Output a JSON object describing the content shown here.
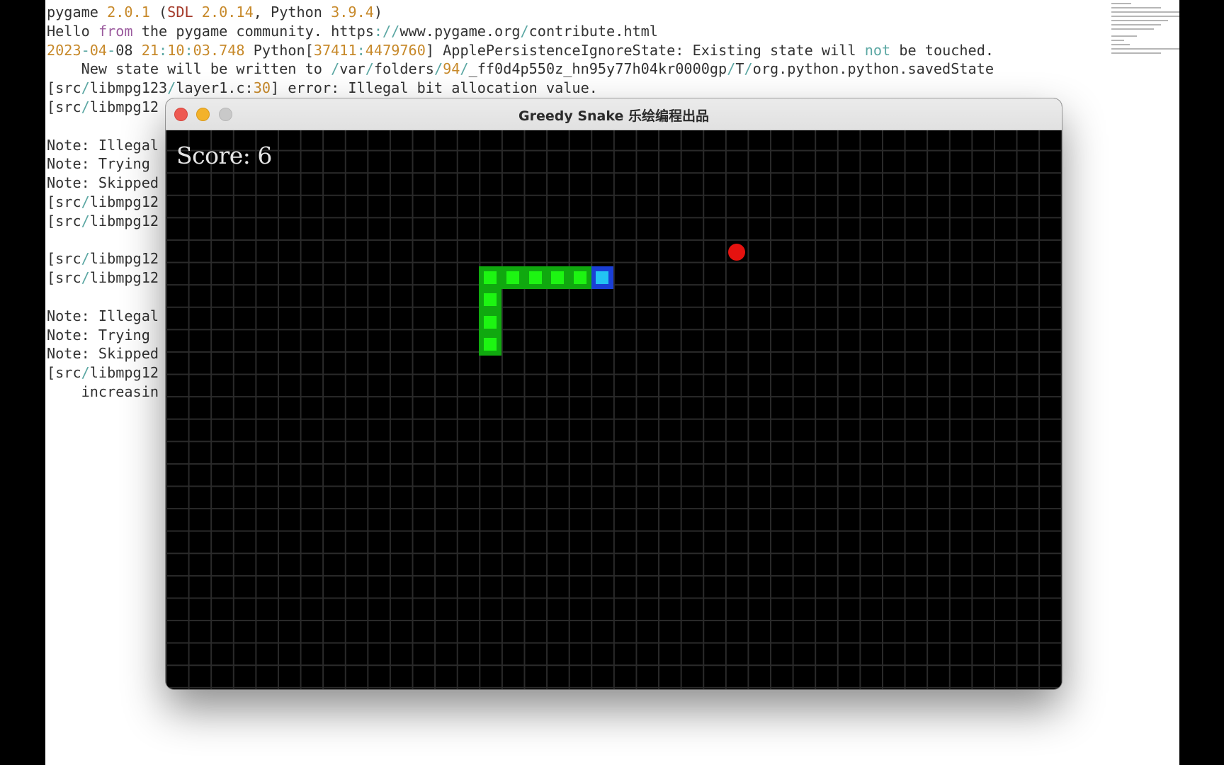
{
  "console": {
    "lines": [
      [
        {
          "t": "pygame "
        },
        {
          "t": "2.0.1",
          "c": "num"
        },
        {
          "t": " ("
        },
        {
          "t": "SDL",
          "c": "red"
        },
        {
          "t": " "
        },
        {
          "t": "2.0.14",
          "c": "num"
        },
        {
          "t": ", Python "
        },
        {
          "t": "3.9.4",
          "c": "num"
        },
        {
          "t": ")"
        }
      ],
      [
        {
          "t": "Hello "
        },
        {
          "t": "from",
          "c": "kw"
        },
        {
          "t": " the pygame community. https"
        },
        {
          "t": ":",
          "c": "sep"
        },
        {
          "t": "//",
          "c": "sep"
        },
        {
          "t": "www.pygame.org"
        },
        {
          "t": "/",
          "c": "sep"
        },
        {
          "t": "contribute.html"
        }
      ],
      [
        {
          "t": "2023",
          "c": "num"
        },
        {
          "t": "-",
          "c": "sep"
        },
        {
          "t": "04",
          "c": "num"
        },
        {
          "t": "-",
          "c": "sep"
        },
        {
          "t": "08 "
        },
        {
          "t": "21",
          "c": "num"
        },
        {
          "t": ":",
          "c": "sep"
        },
        {
          "t": "10",
          "c": "num"
        },
        {
          "t": ":",
          "c": "sep"
        },
        {
          "t": "03.748",
          "c": "num"
        },
        {
          "t": " Python["
        },
        {
          "t": "37411",
          "c": "num"
        },
        {
          "t": ":",
          "c": "sep"
        },
        {
          "t": "4479760",
          "c": "num"
        },
        {
          "t": "] ApplePersistenceIgnoreState: Existing state will "
        },
        {
          "t": "not",
          "c": "teal"
        },
        {
          "t": " be touched."
        }
      ],
      [
        {
          "t": "    New state will be written to "
        },
        {
          "t": "/",
          "c": "sep"
        },
        {
          "t": "var"
        },
        {
          "t": "/",
          "c": "sep"
        },
        {
          "t": "folders"
        },
        {
          "t": "/",
          "c": "sep"
        },
        {
          "t": "94",
          "c": "num"
        },
        {
          "t": "/",
          "c": "sep"
        },
        {
          "t": "_ff0d4p550z_hn95y77h04kr0000gp"
        },
        {
          "t": "/",
          "c": "sep"
        },
        {
          "t": "T"
        },
        {
          "t": "/",
          "c": "sep"
        },
        {
          "t": "org.python.python.savedState"
        }
      ],
      [
        {
          "t": "[src"
        },
        {
          "t": "/",
          "c": "sep"
        },
        {
          "t": "libmpg123"
        },
        {
          "t": "/",
          "c": "sep"
        },
        {
          "t": "layer1.c:"
        },
        {
          "t": "30",
          "c": "num"
        },
        {
          "t": "] error: Illegal bit allocation value."
        }
      ],
      [
        {
          "t": "[src"
        },
        {
          "t": "/",
          "c": "sep"
        },
        {
          "t": "libmpg12"
        }
      ],
      [
        {
          "t": ""
        }
      ],
      [
        {
          "t": "Note: Illegal"
        }
      ],
      [
        {
          "t": "Note: Trying "
        }
      ],
      [
        {
          "t": "Note: Skipped"
        }
      ],
      [
        {
          "t": "[src"
        },
        {
          "t": "/",
          "c": "sep"
        },
        {
          "t": "libmpg12"
        }
      ],
      [
        {
          "t": "[src"
        },
        {
          "t": "/",
          "c": "sep"
        },
        {
          "t": "libmpg12"
        }
      ],
      [
        {
          "t": ""
        }
      ],
      [
        {
          "t": "[src"
        },
        {
          "t": "/",
          "c": "sep"
        },
        {
          "t": "libmpg12"
        }
      ],
      [
        {
          "t": "[src"
        },
        {
          "t": "/",
          "c": "sep"
        },
        {
          "t": "libmpg12"
        }
      ],
      [
        {
          "t": ""
        }
      ],
      [
        {
          "t": "Note: Illegal"
        }
      ],
      [
        {
          "t": "Note: Trying "
        }
      ],
      [
        {
          "t": "Note: Skipped"
        }
      ],
      [
        {
          "t": "[src"
        },
        {
          "t": "/",
          "c": "sep"
        },
        {
          "t": "libmpg12"
        }
      ],
      [
        {
          "t": "    increasin"
        }
      ]
    ]
  },
  "game_window": {
    "title": "Greedy Snake 乐绘编程出品",
    "score_text": "Score: 6"
  },
  "game": {
    "grid_cols": 40,
    "grid_rows": 25,
    "snake": [
      {
        "col": 19,
        "row": 6,
        "head": true
      },
      {
        "col": 18,
        "row": 6
      },
      {
        "col": 17,
        "row": 6
      },
      {
        "col": 16,
        "row": 6
      },
      {
        "col": 15,
        "row": 6
      },
      {
        "col": 14,
        "row": 6
      },
      {
        "col": 14,
        "row": 7
      },
      {
        "col": 14,
        "row": 8
      },
      {
        "col": 14,
        "row": 9
      }
    ],
    "food": {
      "col": 25,
      "row": 5
    },
    "colors": {
      "background": "#000000",
      "grid": "#2a2a2a",
      "snake_body": "#10a80f",
      "snake_body_inner": "#1df512",
      "snake_head": "#1a3fd6",
      "snake_head_inner": "#22c3f3",
      "food": "#e5120f"
    }
  }
}
